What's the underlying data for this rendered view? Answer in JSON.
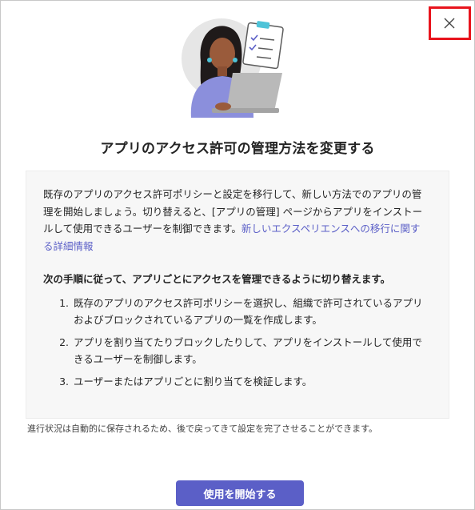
{
  "dialog": {
    "title": "アプリのアクセス許可の管理方法を変更する",
    "intro_text": "既存のアプリのアクセス許可ポリシーと設定を移行して、新しい方法でのアプリの管理を開始しましょう。切り替えると、[アプリの管理] ページからアプリをインストールして使用できるユーザーを制御できます。",
    "intro_link": "新しいエクスペリエンスへの移行に関する詳細情報",
    "steps_heading": "次の手順に従って、アプリごとにアクセスを管理できるように切り替えます。",
    "steps": [
      "既存のアプリのアクセス許可ポリシーを選択し、組織で許可されているアプリおよびブロックされているアプリの一覧を作成します。",
      "アプリを割り当てたりブロックしたりして、アプリをインストールして使用できるユーザーを制御します。",
      "ユーザーまたはアプリごとに割り当てを検証します。"
    ],
    "note": "進行状況は自動的に保存されるため、後で戻ってきて設定を完了させることができます。",
    "primary_button": "使用を開始する",
    "close_icon": "close-icon",
    "colors": {
      "accent": "#5b5fc7",
      "highlight": "#e8141d"
    }
  }
}
